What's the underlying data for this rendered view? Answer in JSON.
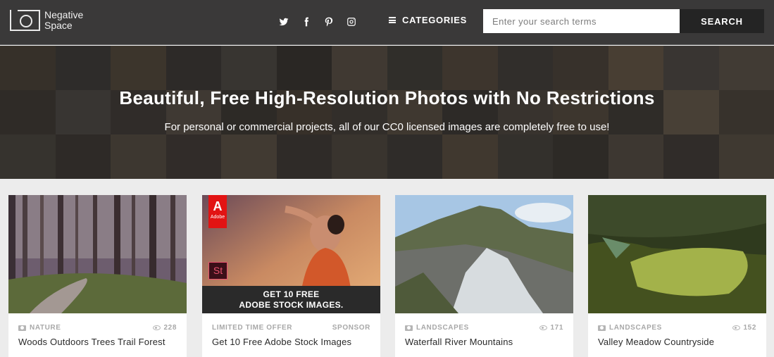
{
  "brand": {
    "line1": "Negative",
    "line2": "Space"
  },
  "social": [
    {
      "name": "twitter-icon"
    },
    {
      "name": "facebook-icon"
    },
    {
      "name": "pinterest-icon"
    },
    {
      "name": "instagram-icon"
    }
  ],
  "nav": {
    "categories_label": "CATEGORIES"
  },
  "search": {
    "placeholder": "Enter your search terms",
    "button_label": "SEARCH"
  },
  "hero": {
    "title": "Beautiful, Free High-Resolution Photos with No Restrictions",
    "subtitle": "For personal or commercial projects, all of our CC0 licensed images are completely free to use!"
  },
  "cards": [
    {
      "category": "NATURE",
      "views": "228",
      "title": "Woods Outdoors Trees Trail Forest"
    },
    {
      "category": "LIMITED TIME OFFER",
      "badge": "SPONSOR",
      "title": "Get 10 Free Adobe Stock Images",
      "banner_line1": "GET 10 FREE",
      "banner_line2": "ADOBE STOCK IMAGES.",
      "logo_text": "Adobe",
      "st_text": "St"
    },
    {
      "category": "LANDSCAPES",
      "views": "171",
      "title": "Waterfall River Mountains"
    },
    {
      "category": "LANDSCAPES",
      "views": "152",
      "title": "Valley Meadow Countryside"
    }
  ],
  "colors": {
    "header_bg": "#3a3939",
    "search_btn_bg": "#242424",
    "adobe_red": "#e21313"
  }
}
